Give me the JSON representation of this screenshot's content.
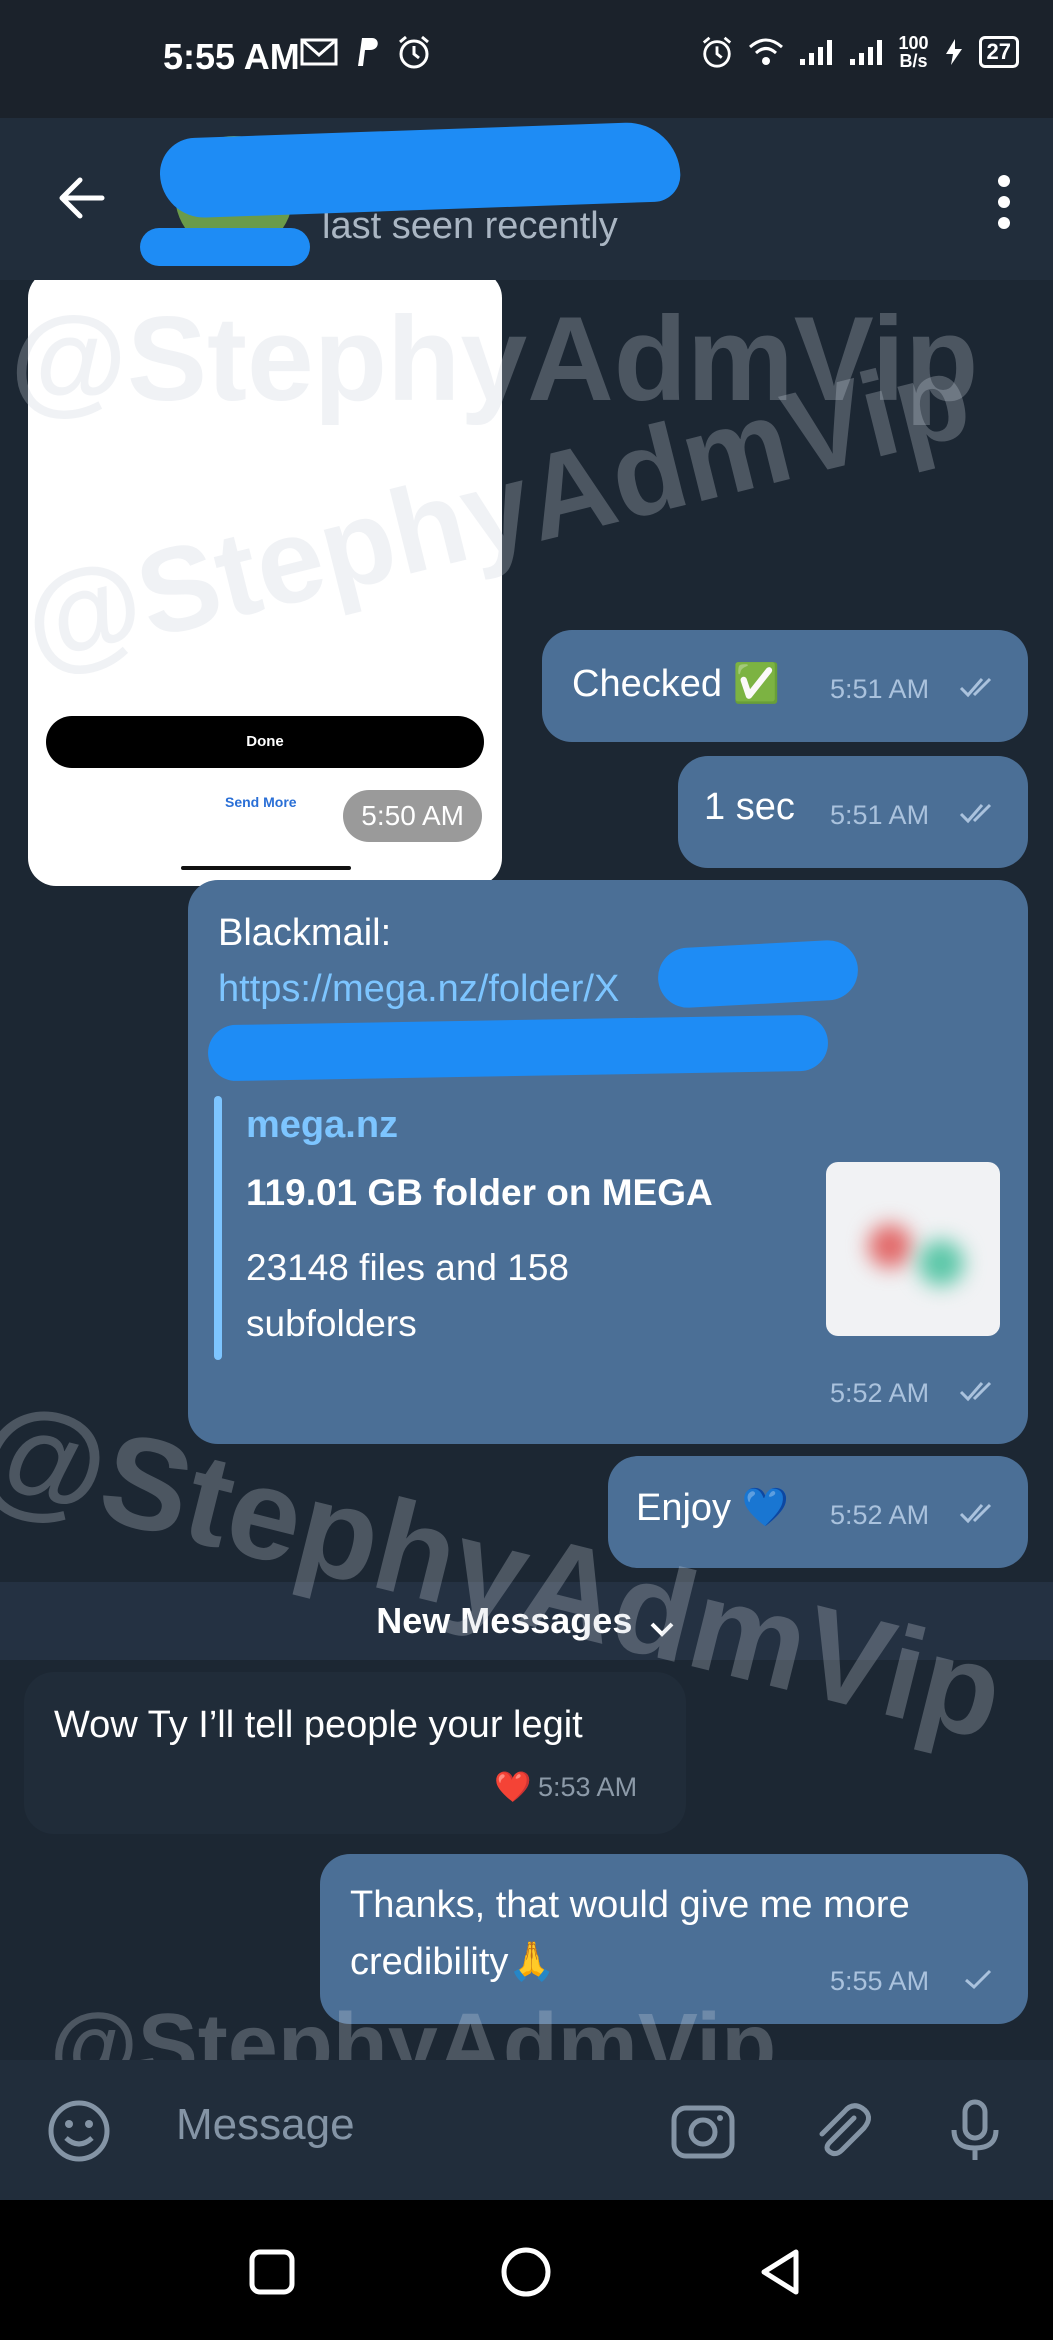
{
  "status_bar": {
    "time": "5:55 AM",
    "net_speed_top": "100",
    "net_speed_bottom": "B/s",
    "battery": "27"
  },
  "header": {
    "subtitle": "last seen recently"
  },
  "image_message": {
    "button_label": "Done",
    "link_label": "Send More",
    "time": "5:50 AM"
  },
  "messages": [
    {
      "id": "m1",
      "direction": "out",
      "text": "Checked ✅",
      "time": "5:51 AM",
      "status": "read"
    },
    {
      "id": "m2",
      "direction": "out",
      "text": "1 sec",
      "time": "5:51 AM",
      "status": "read"
    },
    {
      "id": "m3",
      "direction": "out",
      "label": "Blackmail:",
      "link": "https://mega.nz/folder/X",
      "preview": {
        "site": "mega.nz",
        "title": "119.01 GB folder on MEGA",
        "description": "23148 files and 158 subfolders"
      },
      "time": "5:52 AM",
      "status": "read"
    },
    {
      "id": "m4",
      "direction": "out",
      "text": "Enjoy 💙",
      "time": "5:52 AM",
      "status": "read"
    },
    {
      "id": "m5",
      "direction": "in",
      "text": "Wow Ty I’ll tell people your legit",
      "reaction": "❤️",
      "time": "5:53 AM"
    },
    {
      "id": "m6",
      "direction": "out",
      "text_line1": "Thanks, that would give me more",
      "text_line2": "credibility🙏",
      "time": "5:55 AM",
      "status": "sent"
    }
  ],
  "new_messages_divider": "New Messages",
  "composer": {
    "placeholder": "Message"
  },
  "watermark": "@StephyAdmVip"
}
